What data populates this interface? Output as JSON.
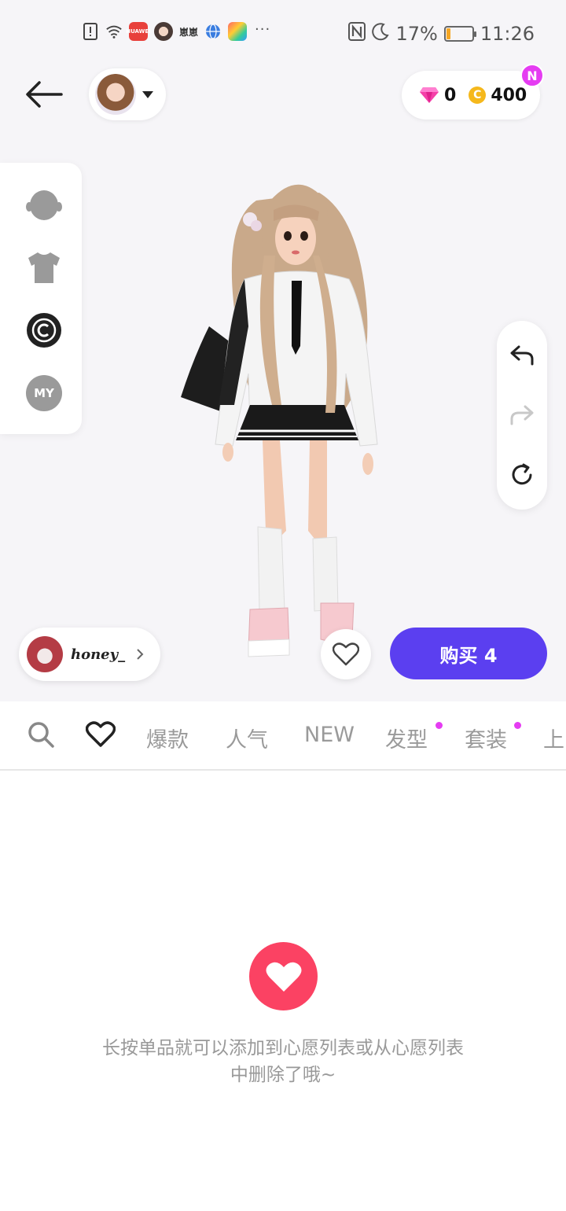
{
  "status_bar": {
    "app_label_red": "HUAWEI",
    "app_label_dm": "崽崽",
    "more": "···",
    "battery": "17%",
    "battery_level": 0.17,
    "time": "11:26"
  },
  "header": {
    "diamonds": "0",
    "coins": "400",
    "coin_symbol": "C",
    "new_badge": "N"
  },
  "left_panel": {
    "items": [
      "head-icon",
      "shirt-icon",
      "copyright-icon",
      "my"
    ],
    "my_label": "MY"
  },
  "right_panel": {
    "buttons": [
      "undo-icon",
      "redo-icon",
      "reset-icon"
    ]
  },
  "creator": {
    "name": "honey_"
  },
  "actions": {
    "buy_label": "购买 4"
  },
  "tabs": {
    "items": [
      {
        "label": "爆款",
        "dot": false
      },
      {
        "label": "人气",
        "dot": false
      },
      {
        "label": "NEW",
        "dot": false
      },
      {
        "label": "发型",
        "dot": true
      },
      {
        "label": "套装",
        "dot": true
      },
      {
        "label": "上",
        "dot": false
      }
    ]
  },
  "empty_state": {
    "line1": "长按单品就可以添加到心愿列表或从心愿列表",
    "line2": "中删除了哦~"
  },
  "colors": {
    "accent_purple": "#5b3ff0",
    "badge_magenta": "#e53cf2",
    "heart_red": "#fb4263",
    "coin_gold": "#f5b81c"
  }
}
